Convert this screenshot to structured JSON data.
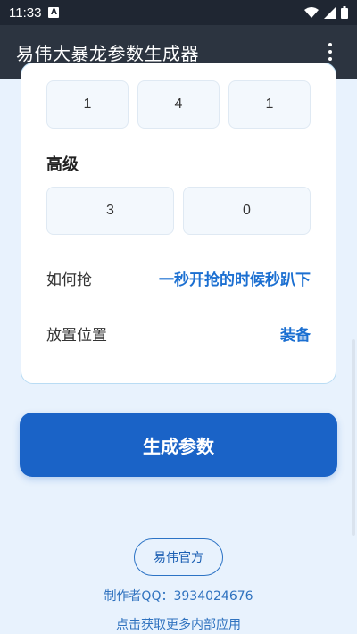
{
  "status_bar": {
    "time": "11:33",
    "notif_letter": "A"
  },
  "app_bar": {
    "title": "易伟大暴龙参数生成器"
  },
  "card": {
    "top_values": [
      "1",
      "4",
      "1"
    ],
    "advanced_label": "高级",
    "advanced_values": [
      "3",
      "0"
    ],
    "how_to_grab_label": "如何抢",
    "how_to_grab_value": "一秒开抢的时候秒趴下",
    "place_position_label": "放置位置",
    "place_position_value": "装备"
  },
  "generate_button": "生成参数",
  "official_button": "易伟官方",
  "author": "制作者QQ：3934024676",
  "more_apps_link": "点击获取更多内部应用",
  "colors": {
    "primary": "#1a63c7",
    "accent_text": "#1b6fd1",
    "background": "#e8f2fd",
    "app_bar": "#2c3440"
  }
}
